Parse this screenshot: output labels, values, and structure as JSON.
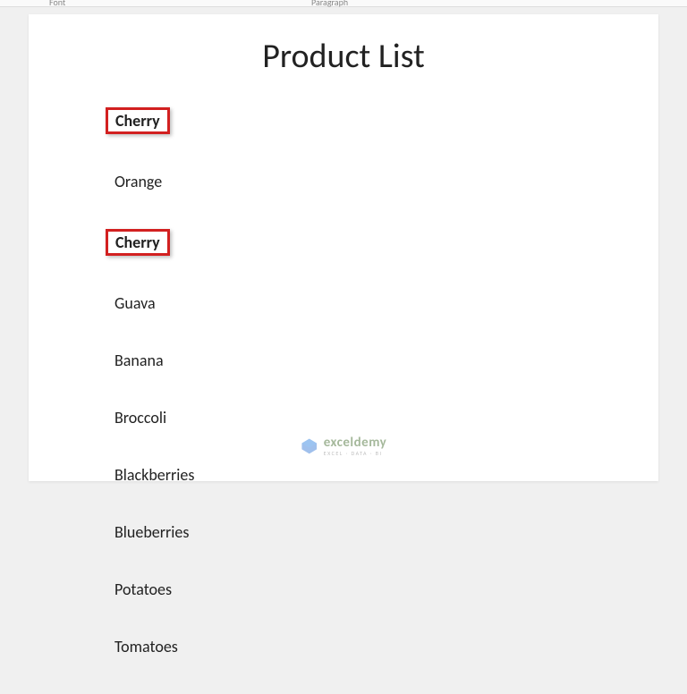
{
  "ribbon": {
    "label_left": "Font",
    "label_right": "Paragraph"
  },
  "document": {
    "title": "Product List",
    "items": [
      {
        "label": "Cherry",
        "highlighted": true
      },
      {
        "label": "Orange",
        "highlighted": false
      },
      {
        "label": "Cherry",
        "highlighted": true
      },
      {
        "label": "Guava",
        "highlighted": false
      },
      {
        "label": "Banana",
        "highlighted": false
      },
      {
        "label": "Broccoli",
        "highlighted": false
      },
      {
        "label": "Blackberries",
        "highlighted": false
      },
      {
        "label": "Blueberries",
        "highlighted": false
      },
      {
        "label": "Potatoes",
        "highlighted": false
      },
      {
        "label": "Tomatoes",
        "highlighted": false
      }
    ]
  },
  "watermark": {
    "brand": "exceldemy",
    "tagline": "EXCEL · DATA · BI"
  }
}
